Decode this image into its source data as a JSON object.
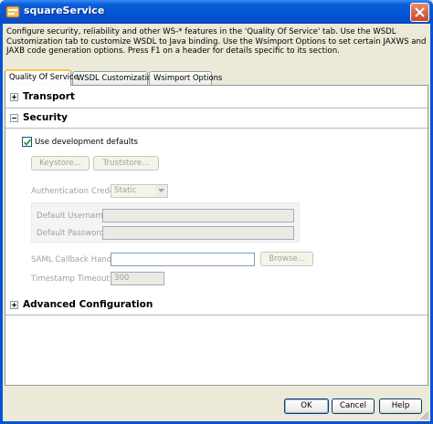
{
  "window": {
    "title": "squareService"
  },
  "description": "Configure security, reliability and other WS-* features in the 'Quality Of Service' tab. Use the WSDL Customization tab to customize WSDL to Java binding. Use the Wsimport Options to set certain JAXWS and JAXB code generation options. Press F1 on a header for details specific to its section.",
  "tabs": [
    {
      "label": "Quality Of Service",
      "active": true
    },
    {
      "label": "WSDL Customization",
      "active": false
    },
    {
      "label": "Wsimport Options",
      "active": false
    }
  ],
  "sections": {
    "transport": {
      "label": "Transport",
      "expanded": false,
      "icon": "plus-expander-icon"
    },
    "security": {
      "label": "Security",
      "expanded": true,
      "icon": "minus-expander-icon",
      "use_defaults": {
        "label": "Use development defaults",
        "checked": true
      },
      "keystore_button": "Keystore...",
      "truststore_button": "Truststore...",
      "auth_credentials": {
        "label": "Authentication Credentials:",
        "value": "Static"
      },
      "default_username": {
        "label": "Default Username:",
        "value": ""
      },
      "default_password": {
        "label": "Default Password:",
        "value": ""
      },
      "saml_callback": {
        "label": "SAML Callback Handler:",
        "value": "",
        "browse_label": "Browse..."
      },
      "timestamp_timeout": {
        "label": "Timestamp Timeout (s):",
        "value": "300"
      }
    },
    "advanced": {
      "label": "Advanced Configuration",
      "expanded": false,
      "icon": "plus-expander-icon"
    }
  },
  "buttons": {
    "ok": "OK",
    "cancel": "Cancel",
    "help": "Help"
  },
  "colors": {
    "titlebar": "#0453d4",
    "dialog_bg": "#ece9d8",
    "tab_highlight": "#ffc83c",
    "disabled_text": "#a0a0a0"
  }
}
